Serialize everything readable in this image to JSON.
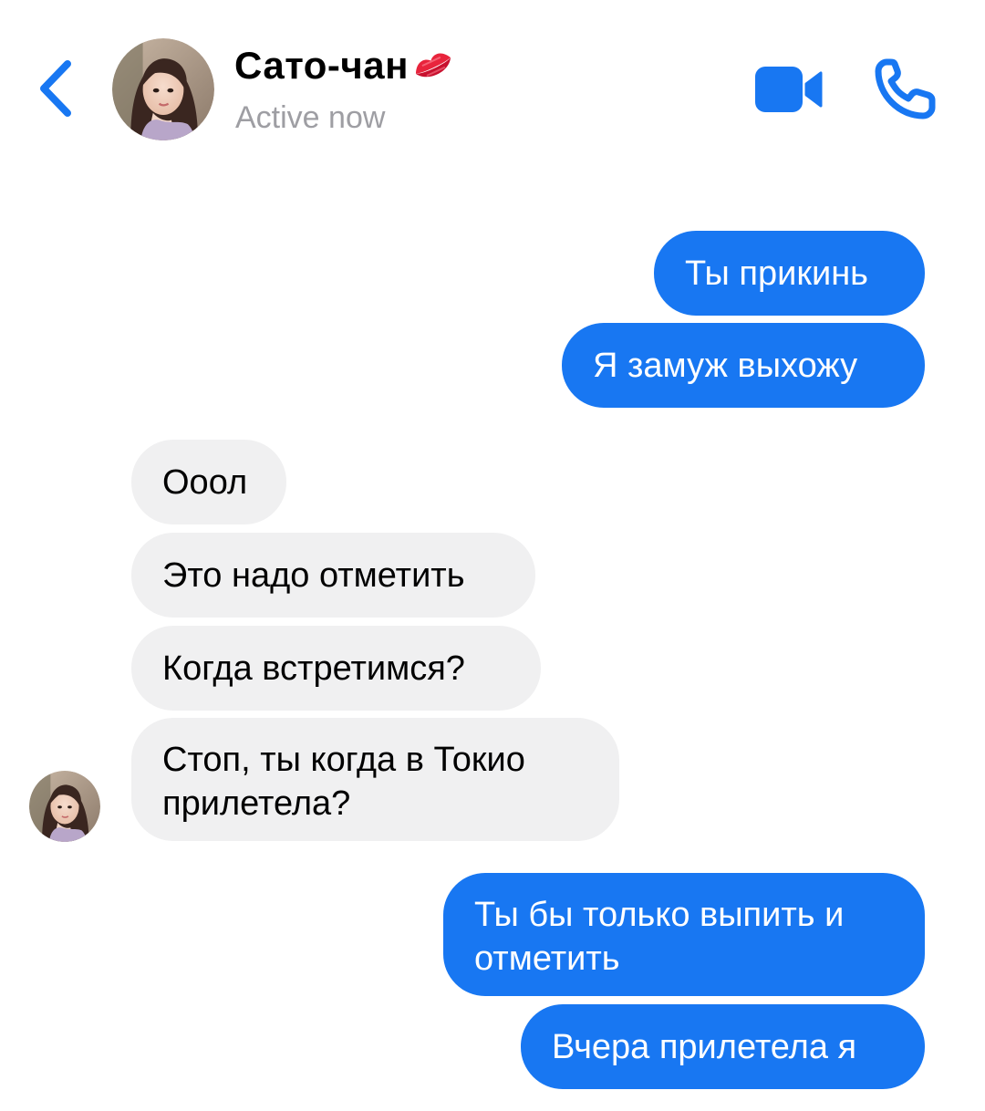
{
  "header": {
    "back_icon": "chevron-left-icon",
    "contact_name": "Сато-чан",
    "name_emoji_icon": "kiss-lips-icon",
    "status": "Active now",
    "video_icon": "video-camera-icon",
    "call_icon": "phone-icon",
    "accent_color": "#1877f2"
  },
  "messages": [
    {
      "direction": "outgoing",
      "text": "Ты прикинь"
    },
    {
      "direction": "outgoing",
      "text": "Я замуж выхожу"
    },
    {
      "direction": "incoming",
      "text": "Ооол"
    },
    {
      "direction": "incoming",
      "text": "Это надо отметить"
    },
    {
      "direction": "incoming",
      "text": "Когда встретимся?"
    },
    {
      "direction": "incoming",
      "text": "Стоп, ты когда в Токио\nприлетела?"
    },
    {
      "direction": "outgoing",
      "text": "Ты бы только выпить и\nотметить"
    },
    {
      "direction": "outgoing",
      "text": "Вчера прилетела я"
    }
  ],
  "colors": {
    "outgoing_bubble": "#1877f2",
    "incoming_bubble": "#f0f0f1",
    "status_text": "#9e9ea3"
  }
}
